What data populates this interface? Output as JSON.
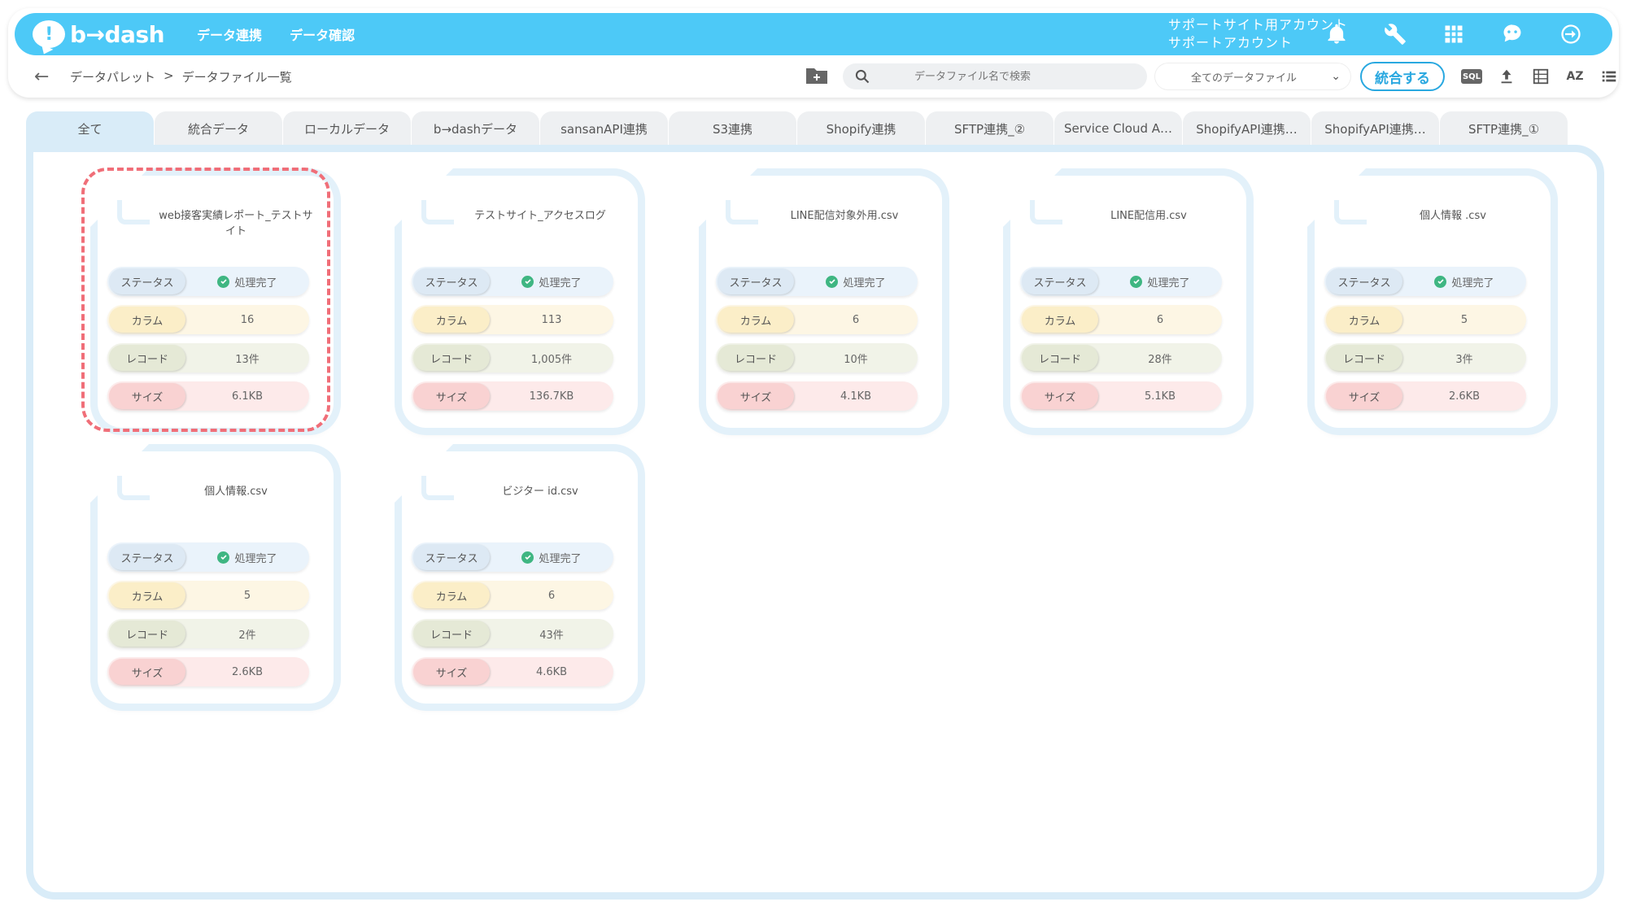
{
  "app": {
    "logo_text": "b→dash",
    "logo_mark": "!",
    "nav": [
      "データ連携",
      "データ確認"
    ],
    "account_line1": "サポートサイト用アカウント",
    "account_line2": "サポートアカウント",
    "header_icons": [
      "bell-icon",
      "wrench-icon",
      "grid-icon",
      "robot-icon",
      "logout-icon"
    ],
    "brand_color": "#4dc9f7"
  },
  "breadcrumb": {
    "items": [
      "データパレット",
      ">",
      "データファイル一覧"
    ]
  },
  "toolbar": {
    "search_placeholder": "データファイル名で検索",
    "filter_value": "全てのデータファイル",
    "merge_label": "統合する",
    "sql_label": "SQL",
    "sort_label": "AZ"
  },
  "tabs": [
    "全て",
    "統合データ",
    "ローカルデータ",
    "b→dashデータ",
    "sansanAPI連携",
    "S3連携",
    "Shopify連携",
    "SFTP連携_②",
    "Service Cloud A…",
    "ShopifyAPI連携…",
    "ShopifyAPI連携…",
    "SFTP連携_①"
  ],
  "active_tab": "全て",
  "row_labels": {
    "status": "ステータス",
    "columns": "カラム",
    "records": "レコード",
    "size": "サイズ"
  },
  "files": [
    {
      "name": "web接客実績レポート_テストサイト",
      "status": "処理完了",
      "columns": "16",
      "records": "13件",
      "size": "6.1KB",
      "selected": true
    },
    {
      "name": "テストサイト_アクセスログ",
      "status": "処理完了",
      "columns": "113",
      "records": "1,005件",
      "size": "136.7KB",
      "selected": false
    },
    {
      "name": "LINE配信対象外用.csv",
      "status": "処理完了",
      "columns": "6",
      "records": "10件",
      "size": "4.1KB",
      "selected": false
    },
    {
      "name": "LINE配信用.csv",
      "status": "処理完了",
      "columns": "6",
      "records": "28件",
      "size": "5.1KB",
      "selected": false
    },
    {
      "name": "個人情報 .csv",
      "status": "処理完了",
      "columns": "5",
      "records": "3件",
      "size": "2.6KB",
      "selected": false
    },
    {
      "name": "個人情報.csv",
      "status": "処理完了",
      "columns": "5",
      "records": "2件",
      "size": "2.6KB",
      "selected": false
    },
    {
      "name": "ビジター id.csv",
      "status": "処理完了",
      "columns": "6",
      "records": "43件",
      "size": "4.6KB",
      "selected": false
    }
  ]
}
